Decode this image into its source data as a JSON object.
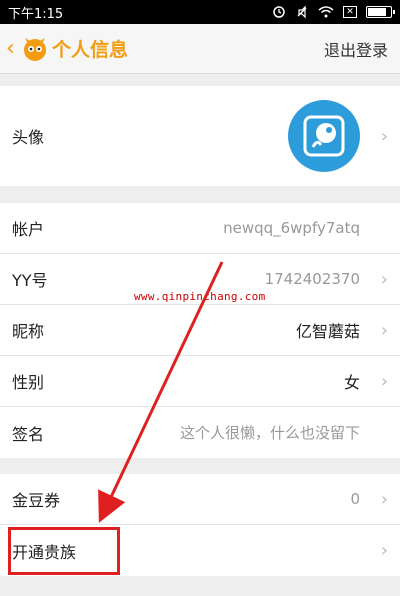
{
  "status_bar": {
    "time": "下午1:15"
  },
  "header": {
    "title": "个人信息",
    "logout_label": "退出登录"
  },
  "profile": {
    "avatar_label": "头像"
  },
  "info": {
    "rows": [
      {
        "label": "帐户",
        "value": "newqq_6wpfy7atq"
      },
      {
        "label": "YY号",
        "value": "1742402370"
      },
      {
        "label": "昵称",
        "value": "亿智蘑菇"
      },
      {
        "label": "性别",
        "value": "女"
      },
      {
        "label": "签名",
        "value": "这个人很懒，什么也没留下"
      }
    ]
  },
  "extras": {
    "rows": [
      {
        "label": "金豆券",
        "value": "0"
      },
      {
        "label": "开通贵族",
        "value": ""
      }
    ]
  },
  "annotation": {
    "watermark": "www.qinpinchang.com",
    "arrow_color": "#e02020"
  },
  "colors": {
    "accent": "#f39c12",
    "avatar_bg": "#2d9cdb"
  }
}
